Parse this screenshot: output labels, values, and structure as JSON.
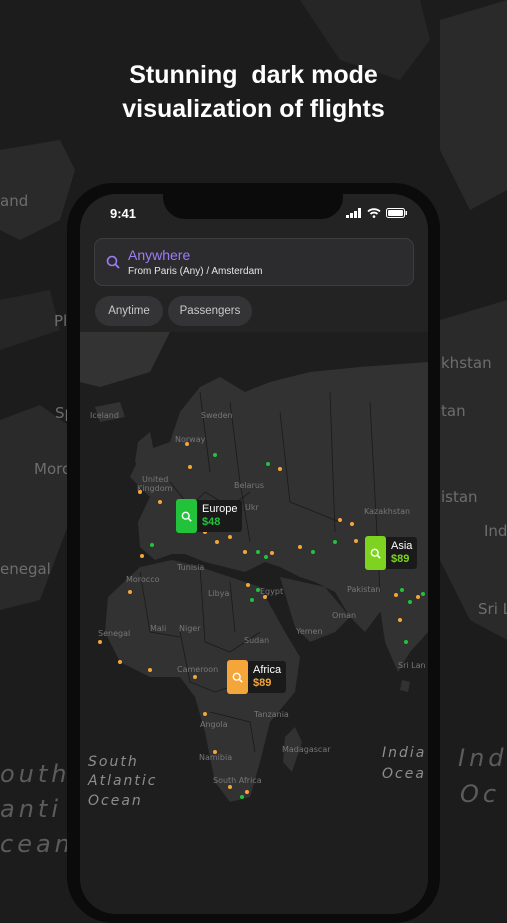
{
  "headline": {
    "line1": "Stunning  dark mode",
    "line2": "visualization of flights"
  },
  "background_labels": {
    "land": "and",
    "morocco": "Moro",
    "senegal": "enegal",
    "sp": "Sp",
    "pl": "Pl",
    "kazakhstan": "khstan",
    "tan": "tan",
    "istan": "istan",
    "ind": "Ind",
    "sri": "Sri L",
    "south": "outh",
    "atlantic": "anti",
    "ocean": "cean",
    "indian": "Ind",
    "oce": "Oc"
  },
  "phone": {
    "time": "9:41",
    "search": {
      "title": "Anywhere",
      "subtitle": "From Paris (Any) / Amsterdam"
    },
    "chips": [
      "Anytime",
      "Passengers"
    ],
    "map_labels": {
      "iceland": "Iceland",
      "sweden": "Sweden",
      "norway": "Norway",
      "uk1": "United",
      "uk2": "Kingdom",
      "belarus": "Belarus",
      "ukraine": "Ukr",
      "kazakhstan": "Kazakhstan",
      "morocco": "Morocco",
      "tunisia": "Tunisia",
      "libya": "Libya",
      "egypt": "Egypt",
      "mali": "Mali",
      "niger": "Niger",
      "senegal": "Senegal",
      "sudan": "Sudan",
      "yemen": "Yemen",
      "oman": "Oman",
      "pakistan": "Pakistan",
      "cameroon": "Cameroon",
      "tanzania": "Tanzania",
      "angola": "Angola",
      "namibia": "Namibia",
      "madagascar": "Madagascar",
      "southafrica": "South Africa",
      "srilanka": "Sri Lan",
      "sa_ocean1": "South",
      "sa_ocean2": "Atlantic",
      "sa_ocean3": "Ocean",
      "in_ocean1": "India",
      "in_ocean2": "Ocea"
    },
    "pins": [
      {
        "name": "Europe",
        "price": "$48",
        "color": "#22c33b"
      },
      {
        "name": "Asia",
        "price": "$89",
        "color": "#7ed321"
      },
      {
        "name": "Africa",
        "price": "$89",
        "color": "#f5a63a"
      }
    ]
  },
  "colors": {
    "accent": "#9d7cf7",
    "dot_green": "#22c33b",
    "dot_orange": "#f5a63a"
  }
}
